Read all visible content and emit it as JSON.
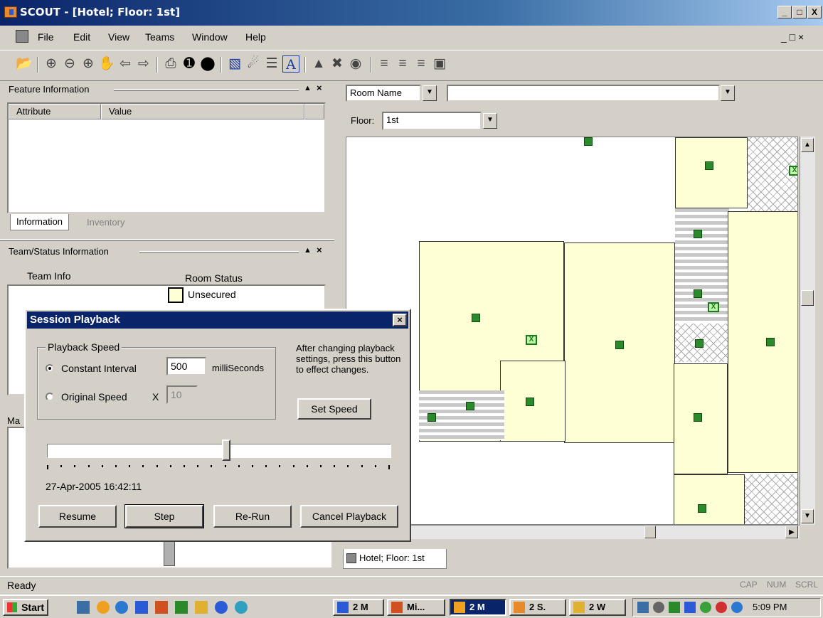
{
  "window": {
    "title": "SCOUT - [Hotel; Floor: 1st]",
    "min": "_",
    "max": "3",
    "close": "X"
  },
  "menu": {
    "items": [
      "File",
      "Edit",
      "View",
      "Teams",
      "Window",
      "Help"
    ]
  },
  "feature_panel": {
    "title": "Feature Information",
    "col_attr": "Attribute",
    "col_value": "Value",
    "tab_info": "Information",
    "tab_inventory": "Inventory"
  },
  "team_panel": {
    "title": "Team/Status Information",
    "team_info": "Team Info",
    "room_status": "Room Status",
    "status_value": "Unsecured"
  },
  "map_panel": {
    "prefix": "Ma"
  },
  "map": {
    "filter_field": "Room Name",
    "filter_value": "",
    "floor_label": "Floor:",
    "floor_value": "1st",
    "tab_label": "Hotel; Floor: 1st"
  },
  "dialog": {
    "title": "Session Playback",
    "group": "Playback Speed",
    "opt_constant": "Constant Interval",
    "interval_value": "500",
    "interval_unit": "milliSeconds",
    "opt_original": "Original Speed",
    "x_label": "X",
    "original_value": "10",
    "note": "After changing playback settings, press this button to effect changes.",
    "set_speed": "Set Speed",
    "timestamp": "27-Apr-2005 16:42:11",
    "slider_fraction": 0.52,
    "buttons": {
      "resume": "Resume",
      "step": "Step",
      "rerun": "Re-Run",
      "cancel": "Cancel Playback"
    }
  },
  "statusbar": {
    "text": "Ready",
    "cap": "CAP",
    "num": "NUM",
    "scrl": "SCRL"
  },
  "taskbar": {
    "start": "Start",
    "tasks": [
      "2 M",
      "Mi...",
      "2 M",
      "2 S.",
      "2 W"
    ],
    "clock": "5:09 PM"
  },
  "colors": {
    "title_bar": "#0a246a",
    "room_fill": "#ffffd6",
    "marker": "#2c8a2c"
  }
}
